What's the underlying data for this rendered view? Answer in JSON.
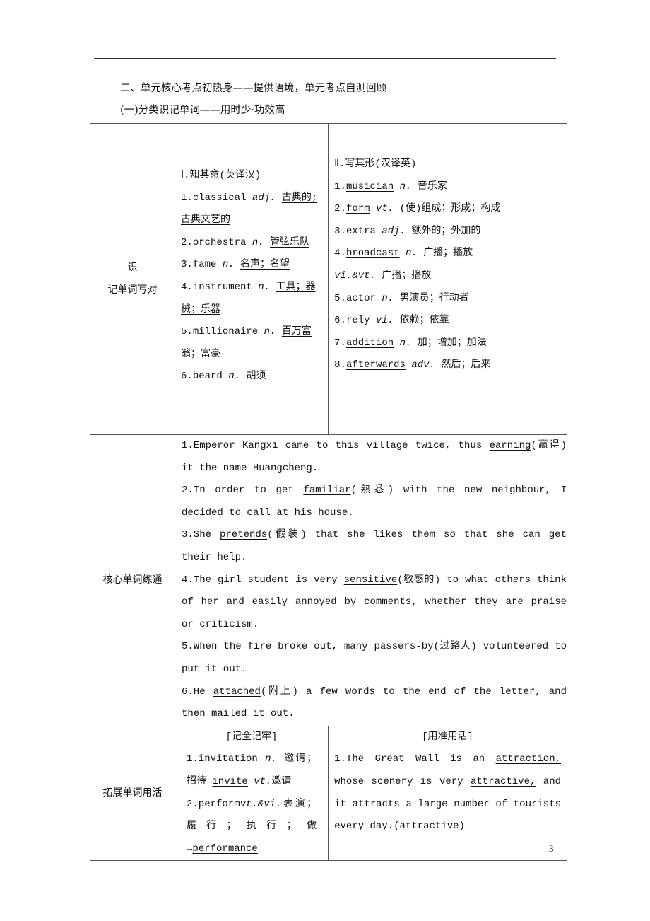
{
  "heading1": "二、单元核心考点初热身——提供语境，单元考点自测回顾",
  "heading2": "(一)分类识记单词——用时少·功效高",
  "row1": {
    "label_a": "识",
    "label_b": "记单词写对",
    "left_title": "Ⅰ.知其意(英译汉)",
    "left_items": [
      {
        "n": "1.",
        "w": "classical",
        "p": "adj.",
        "m": "古典的;古典文艺的"
      },
      {
        "n": "2.",
        "w": "orchestra",
        "p": "n.",
        "m": "管弦乐队"
      },
      {
        "n": "3.",
        "w": "fame",
        "p": "n.",
        "m": "名声；名望"
      },
      {
        "n": "4.",
        "w": "instrument",
        "p": "n.",
        "m": "工具；器械；乐器"
      },
      {
        "n": "5.",
        "w": "millionaire",
        "p": "n.",
        "m": "百万富翁；富豪"
      },
      {
        "n": "6.",
        "w": "beard",
        "p": "n.",
        "m": "胡须"
      }
    ],
    "right_title": "Ⅱ.写其形(汉译英)",
    "right_items": [
      {
        "n": "1.",
        "w": "musician",
        "p": "n.",
        "m": "音乐家"
      },
      {
        "n": "2.",
        "w": "form",
        "p": "vt.",
        "m": "(使)组成；形成；构成"
      },
      {
        "n": "3.",
        "w": "extra",
        "p": "adj.",
        "m": "额外的；外加的"
      },
      {
        "n": "4.",
        "w": "broadcast",
        "p": "n.",
        "m": "广播；播放",
        "p2": "vi.&vt.",
        "m2": "广播；播放"
      },
      {
        "n": "5.",
        "w": "actor",
        "p": "n.",
        "m": "男演员；行动者"
      },
      {
        "n": "6.",
        "w": "rely",
        "p": "vi.",
        "m": "依赖；依靠"
      },
      {
        "n": "7.",
        "w": "addition",
        "p": "n.",
        "m": "加；增加；加法"
      },
      {
        "n": "8.",
        "w": "afterwards",
        "p": "adv.",
        "m": "然后；后来"
      }
    ]
  },
  "row2": {
    "label": "核心单词练通",
    "items": [
      {
        "a": "1.Emperor Kangxi came to this village twice, thus ",
        "w": "earning",
        "g": "(赢得)",
        "b": " it the name Huangcheng."
      },
      {
        "a": "2.In order to get ",
        "w": "familiar",
        "g": "(熟悉)",
        "b": " with the new neighbour, I decided to call at his house."
      },
      {
        "a": "3.She ",
        "w": "pretends",
        "g": "(假装)",
        "b": " that she likes them so that she can get their help."
      },
      {
        "a": "4.The girl student is very ",
        "w": "sensitive",
        "g": "(敏感的)",
        "b": " to what others think of her and easily annoyed by comments, whether they are praise or criticism."
      },
      {
        "a": "5.When the fire broke out, many ",
        "w": "passers-by",
        "g": "(过路人)",
        "b": " volunteered to put it out."
      },
      {
        "a": "6.He ",
        "w": "attached",
        "g": "(附上)",
        "b": " a few words to the end of the letter, and then mailed it out."
      }
    ]
  },
  "row3": {
    "label": "拓展单词用活",
    "left_title": "[记全记牢]",
    "right_title": "[用准用活]",
    "l1a": "1.invitation ",
    "l1p": "n.",
    "l1b": " 邀请；招待→",
    "l1w": "invite",
    "l1p2": " vt.",
    "l1c": "邀请",
    "l2a": "2.perform",
    "l2p": "vt.&vi.",
    "l2b": "表演；履行；执行；做→",
    "l2w": "performance",
    "r_a": "1.The Great Wall is an ",
    "r_w1": "attraction,",
    "r_b": " whose scenery is very ",
    "r_w2": "attractive,",
    "r_c": " and it ",
    "r_w3": "attracts",
    "r_d": " a large number of tourists every day.(attractive)"
  },
  "page_number": "3"
}
